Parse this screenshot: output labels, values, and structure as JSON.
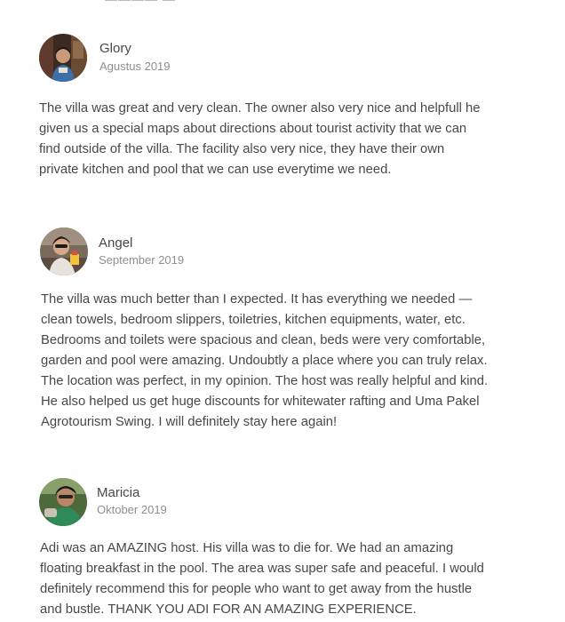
{
  "reviews": [
    {
      "name": "Glory",
      "date": "Agustus 2019",
      "lines": [
        "The villa was great and very clean. The owner also very nice and helpfull he",
        "given us a special maps about directions about tourist activity that we can",
        "find outside of the villa. The facility also very nice, they have their own",
        "private kitchen and pool that we can use everytime we need."
      ]
    },
    {
      "name": "Angel",
      "date": "September 2019",
      "lines": [
        "The villa was much better than I expected. It has everything we needed —",
        "clean towels, bedroom slippers, toiletries, kitchen equipments, water, etc.",
        "Bedrooms and toilets were spacious and clean, beds were very comfortable,",
        "garden and pool were amazing. Undoubtly a place where you can truly relax.",
        "The location was perfect, in my opinion. The host was really helpful and kind.",
        "He also helped us get huge discounts for whitewater rafting and Uma Pakel",
        "Agrotourism Swing. I will definitely stay here again!"
      ]
    },
    {
      "name": "Maricia",
      "date": "Oktober 2019",
      "lines": [
        "Adi was an AMAZING host. His villa was to die for. We had an amazing",
        "floating breakfast in the pool. The area was super safe and peaceful. I would",
        "definitely recommend this for people who want to get away from the hustle",
        "and bustle. THANK YOU ADI FOR AN AMAZING EXPERIENCE."
      ]
    }
  ]
}
